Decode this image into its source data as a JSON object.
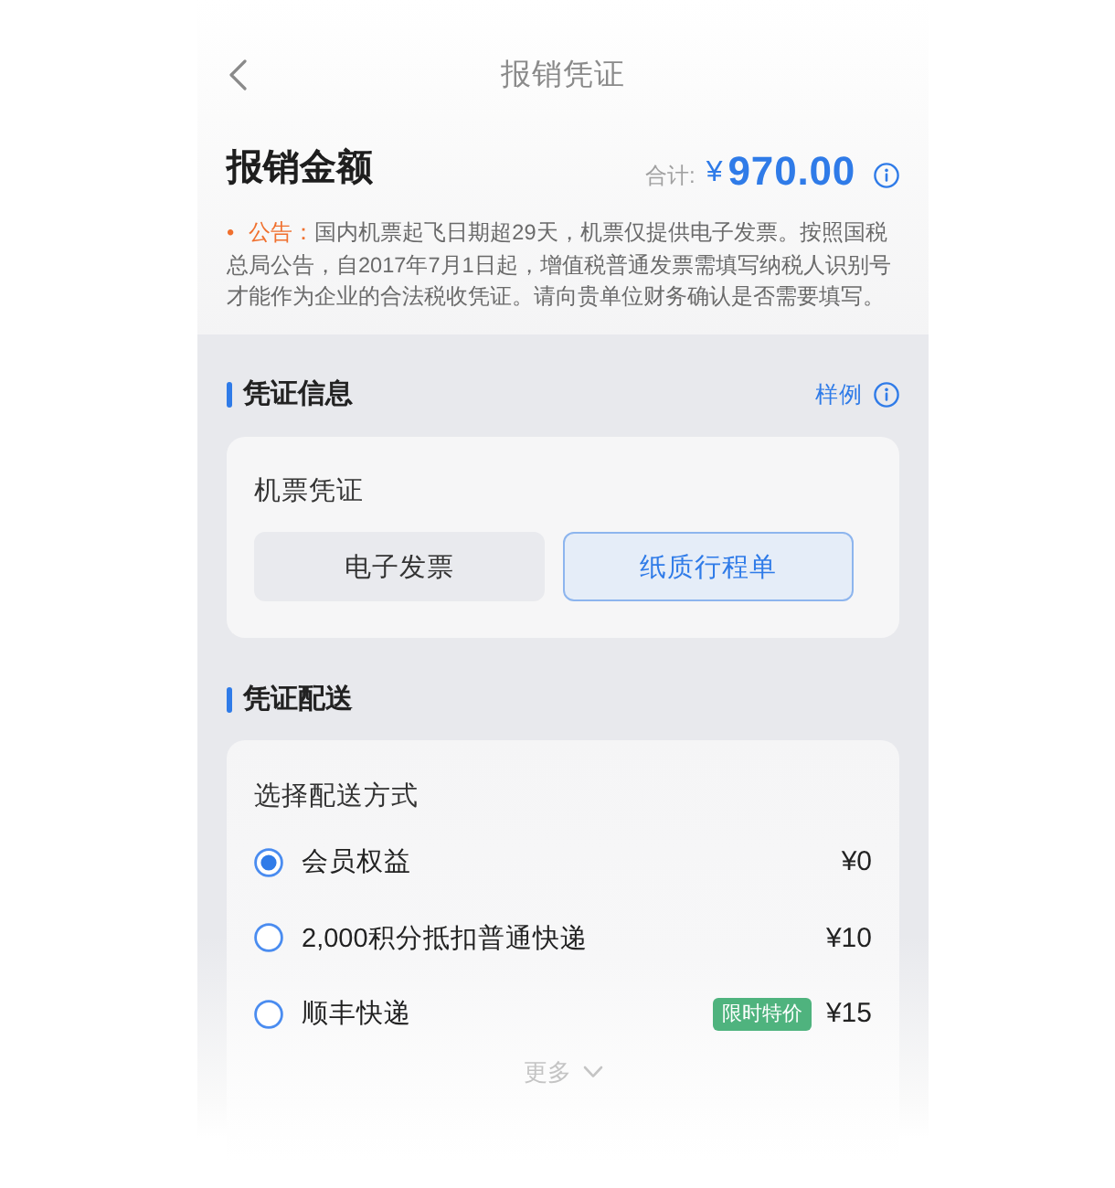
{
  "nav": {
    "title": "报销凭证"
  },
  "amount": {
    "title": "报销金额",
    "total_label": "合计:",
    "currency": "¥",
    "value": "970.00"
  },
  "notice": {
    "bullet": "•",
    "label": "公告：",
    "text": "国内机票起飞日期超29天，机票仅提供电子发票。按照国税总局公告，自2017年7月1日起，增值税普通发票需填写纳税人识别号才能作为企业的合法税收凭证。请向贵单位财务确认是否需要填写。"
  },
  "voucher_info": {
    "title": "凭证信息",
    "link": "样例",
    "card_title": "机票凭证",
    "options": [
      {
        "label": "电子发票",
        "selected": false
      },
      {
        "label": "纸质行程单",
        "selected": true
      }
    ]
  },
  "delivery": {
    "title": "凭证配送",
    "card_title": "选择配送方式",
    "options": [
      {
        "label": "会员权益",
        "price": "¥0",
        "selected": true
      },
      {
        "label": "2,000积分抵扣普通快递",
        "price": "¥10",
        "selected": false
      },
      {
        "label": "顺丰快递",
        "badge": "限时特价",
        "price": "¥15",
        "selected": false
      }
    ],
    "more": "更多"
  }
}
